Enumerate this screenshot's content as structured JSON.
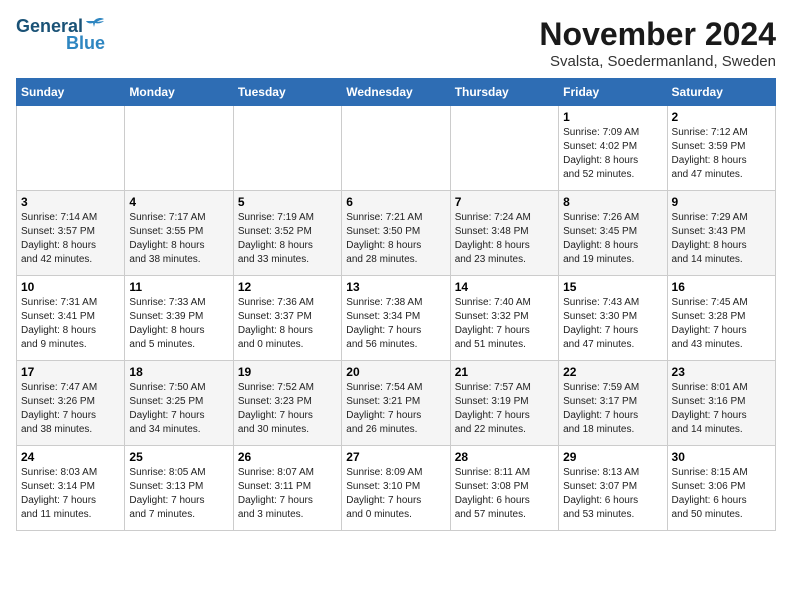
{
  "logo": {
    "line1": "General",
    "line2": "Blue"
  },
  "title": "November 2024",
  "subtitle": "Svalsta, Soedermanland, Sweden",
  "days_of_week": [
    "Sunday",
    "Monday",
    "Tuesday",
    "Wednesday",
    "Thursday",
    "Friday",
    "Saturday"
  ],
  "weeks": [
    [
      {
        "day": "",
        "info": ""
      },
      {
        "day": "",
        "info": ""
      },
      {
        "day": "",
        "info": ""
      },
      {
        "day": "",
        "info": ""
      },
      {
        "day": "",
        "info": ""
      },
      {
        "day": "1",
        "info": "Sunrise: 7:09 AM\nSunset: 4:02 PM\nDaylight: 8 hours\nand 52 minutes."
      },
      {
        "day": "2",
        "info": "Sunrise: 7:12 AM\nSunset: 3:59 PM\nDaylight: 8 hours\nand 47 minutes."
      }
    ],
    [
      {
        "day": "3",
        "info": "Sunrise: 7:14 AM\nSunset: 3:57 PM\nDaylight: 8 hours\nand 42 minutes."
      },
      {
        "day": "4",
        "info": "Sunrise: 7:17 AM\nSunset: 3:55 PM\nDaylight: 8 hours\nand 38 minutes."
      },
      {
        "day": "5",
        "info": "Sunrise: 7:19 AM\nSunset: 3:52 PM\nDaylight: 8 hours\nand 33 minutes."
      },
      {
        "day": "6",
        "info": "Sunrise: 7:21 AM\nSunset: 3:50 PM\nDaylight: 8 hours\nand 28 minutes."
      },
      {
        "day": "7",
        "info": "Sunrise: 7:24 AM\nSunset: 3:48 PM\nDaylight: 8 hours\nand 23 minutes."
      },
      {
        "day": "8",
        "info": "Sunrise: 7:26 AM\nSunset: 3:45 PM\nDaylight: 8 hours\nand 19 minutes."
      },
      {
        "day": "9",
        "info": "Sunrise: 7:29 AM\nSunset: 3:43 PM\nDaylight: 8 hours\nand 14 minutes."
      }
    ],
    [
      {
        "day": "10",
        "info": "Sunrise: 7:31 AM\nSunset: 3:41 PM\nDaylight: 8 hours\nand 9 minutes."
      },
      {
        "day": "11",
        "info": "Sunrise: 7:33 AM\nSunset: 3:39 PM\nDaylight: 8 hours\nand 5 minutes."
      },
      {
        "day": "12",
        "info": "Sunrise: 7:36 AM\nSunset: 3:37 PM\nDaylight: 8 hours\nand 0 minutes."
      },
      {
        "day": "13",
        "info": "Sunrise: 7:38 AM\nSunset: 3:34 PM\nDaylight: 7 hours\nand 56 minutes."
      },
      {
        "day": "14",
        "info": "Sunrise: 7:40 AM\nSunset: 3:32 PM\nDaylight: 7 hours\nand 51 minutes."
      },
      {
        "day": "15",
        "info": "Sunrise: 7:43 AM\nSunset: 3:30 PM\nDaylight: 7 hours\nand 47 minutes."
      },
      {
        "day": "16",
        "info": "Sunrise: 7:45 AM\nSunset: 3:28 PM\nDaylight: 7 hours\nand 43 minutes."
      }
    ],
    [
      {
        "day": "17",
        "info": "Sunrise: 7:47 AM\nSunset: 3:26 PM\nDaylight: 7 hours\nand 38 minutes."
      },
      {
        "day": "18",
        "info": "Sunrise: 7:50 AM\nSunset: 3:25 PM\nDaylight: 7 hours\nand 34 minutes."
      },
      {
        "day": "19",
        "info": "Sunrise: 7:52 AM\nSunset: 3:23 PM\nDaylight: 7 hours\nand 30 minutes."
      },
      {
        "day": "20",
        "info": "Sunrise: 7:54 AM\nSunset: 3:21 PM\nDaylight: 7 hours\nand 26 minutes."
      },
      {
        "day": "21",
        "info": "Sunrise: 7:57 AM\nSunset: 3:19 PM\nDaylight: 7 hours\nand 22 minutes."
      },
      {
        "day": "22",
        "info": "Sunrise: 7:59 AM\nSunset: 3:17 PM\nDaylight: 7 hours\nand 18 minutes."
      },
      {
        "day": "23",
        "info": "Sunrise: 8:01 AM\nSunset: 3:16 PM\nDaylight: 7 hours\nand 14 minutes."
      }
    ],
    [
      {
        "day": "24",
        "info": "Sunrise: 8:03 AM\nSunset: 3:14 PM\nDaylight: 7 hours\nand 11 minutes."
      },
      {
        "day": "25",
        "info": "Sunrise: 8:05 AM\nSunset: 3:13 PM\nDaylight: 7 hours\nand 7 minutes."
      },
      {
        "day": "26",
        "info": "Sunrise: 8:07 AM\nSunset: 3:11 PM\nDaylight: 7 hours\nand 3 minutes."
      },
      {
        "day": "27",
        "info": "Sunrise: 8:09 AM\nSunset: 3:10 PM\nDaylight: 7 hours\nand 0 minutes."
      },
      {
        "day": "28",
        "info": "Sunrise: 8:11 AM\nSunset: 3:08 PM\nDaylight: 6 hours\nand 57 minutes."
      },
      {
        "day": "29",
        "info": "Sunrise: 8:13 AM\nSunset: 3:07 PM\nDaylight: 6 hours\nand 53 minutes."
      },
      {
        "day": "30",
        "info": "Sunrise: 8:15 AM\nSunset: 3:06 PM\nDaylight: 6 hours\nand 50 minutes."
      }
    ]
  ]
}
